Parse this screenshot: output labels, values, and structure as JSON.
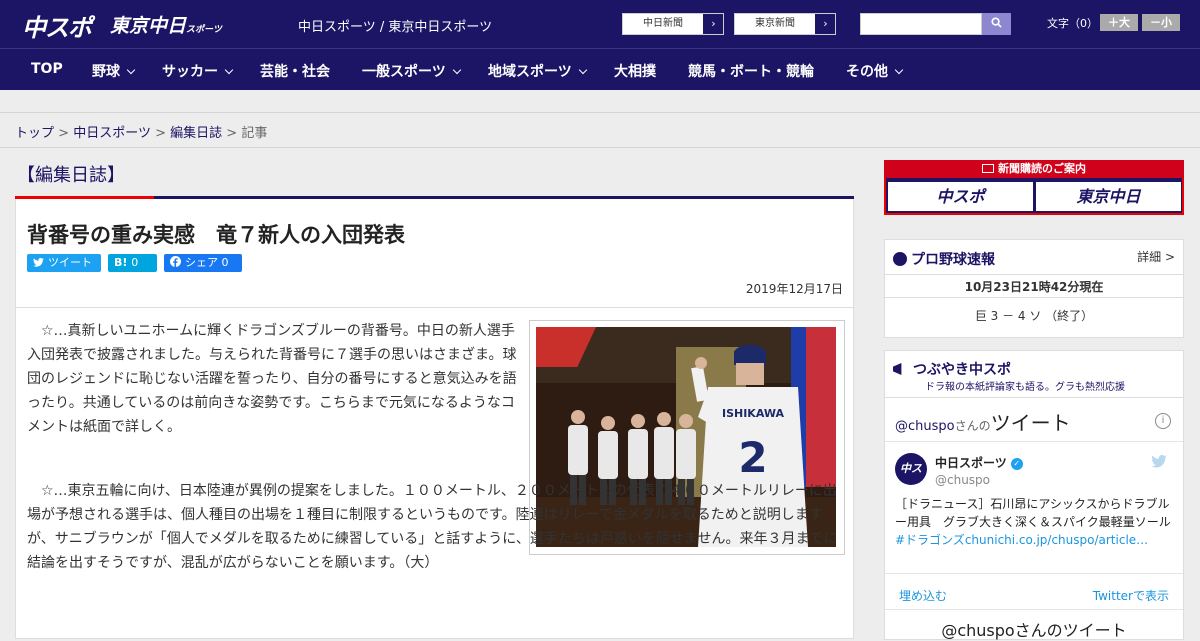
{
  "header": {
    "logo_chuspo": "中スポ",
    "logo_tokyo": "東京中日",
    "logo_tokyo_sub": "スポーツ",
    "site_name": "中日スポーツ / 東京中日スポーツ",
    "link_chunichi": "中日新聞",
    "link_tokyo": "東京新聞",
    "search_placeholder": "",
    "font_label": "文字（0）",
    "font_big": "＋大",
    "font_small": "－小"
  },
  "nav": {
    "items": [
      {
        "label": "TOP",
        "dropdown": false
      },
      {
        "label": "野球",
        "dropdown": true
      },
      {
        "label": "サッカー",
        "dropdown": true
      },
      {
        "label": "芸能・社会",
        "dropdown": false
      },
      {
        "label": "一般スポーツ",
        "dropdown": true
      },
      {
        "label": "地域スポーツ",
        "dropdown": true
      },
      {
        "label": "大相撲",
        "dropdown": false
      },
      {
        "label": "競馬・ボート・競輪",
        "dropdown": false
      },
      {
        "label": "その他",
        "dropdown": true
      }
    ]
  },
  "breadcrumb": {
    "top": "トップ",
    "section": "中日スポーツ",
    "category": "編集日誌",
    "current": "記事",
    "sep": ">"
  },
  "article": {
    "category": "【編集日誌】",
    "headline": "背番号の重み実感　竜７新人の入団発表",
    "share": {
      "tweet": "ツイート",
      "hatena_label": "B!",
      "hatena_count": "0",
      "fb_label": "シェア",
      "fb_count": "0"
    },
    "date": "2019年12月17日",
    "photo_jersey_name": "ISHIKAWA",
    "photo_jersey_number": "2",
    "paragraphs": [
      "☆…真新しいユニホームに輝くドラゴンズブルーの背番号。中日の新人選手入団発表で披露されました。与えられた背番号に７選手の思いはさまざま。球団のレジェンドに恥じない活躍を誓ったり、自分の番号にすると意気込みを語ったり。共通しているのは前向きな姿勢です。こちらまで元気になるようなコメントは紙面で詳しく。",
      "☆…東京五輪に向け、日本陸連が異例の提案をしました。１００メートル、２００メートルの代表で４００メートルリレーに出場が予想される選手は、個人種目の出場を１種目に制限するというものです。陸連はリレーで金メダルを取るためと説明しますが、サニブラウンが「個人でメダルを取るために練習している」と話すように、選手たちは戸惑いを隠せません。来年３月までに結論を出すそうですが、混乱が広がらないことを願います。（大）"
    ]
  },
  "sidebar": {
    "banner_title": "新聞購読のご案内",
    "banner_logo1": "中スポ",
    "banner_logo2": "東京中日",
    "baseball": {
      "title": "プロ野球速報",
      "detail": "詳細 >",
      "time": "10月23日21時42分現在",
      "score": "巨 3 － 4 ソ （終了）"
    },
    "twitter": {
      "title": "つぶやき中スポ",
      "subtitle": "ドラ報の本紙評論家も語る。グラも熱烈応援",
      "heading_account": "@chuspo",
      "heading_suffix": "さんの",
      "heading_main": "ツイート",
      "info": "i",
      "avatar": "中スポ",
      "name": "中日スポーツ",
      "verified": "✓",
      "handle": "@chuspo",
      "tweet_text": "［ドラニュース］石川昂にアシックスからドラブルー用具　グラブ大きく深く＆スパイク最軽量ソール",
      "tweet_link": "#ドラゴンズchunichi.co.jp/chuspo/article…",
      "embed": "埋め込む",
      "view_on_twitter": "Twitterで表示",
      "footer": "@chuspoさんのツイート"
    }
  },
  "colors": {
    "brand_navy": "#1c1464",
    "accent_red": "#e00000",
    "twitter_blue": "#1da1f2",
    "facebook_blue": "#1877f2",
    "hatena_blue": "#00a4de"
  }
}
